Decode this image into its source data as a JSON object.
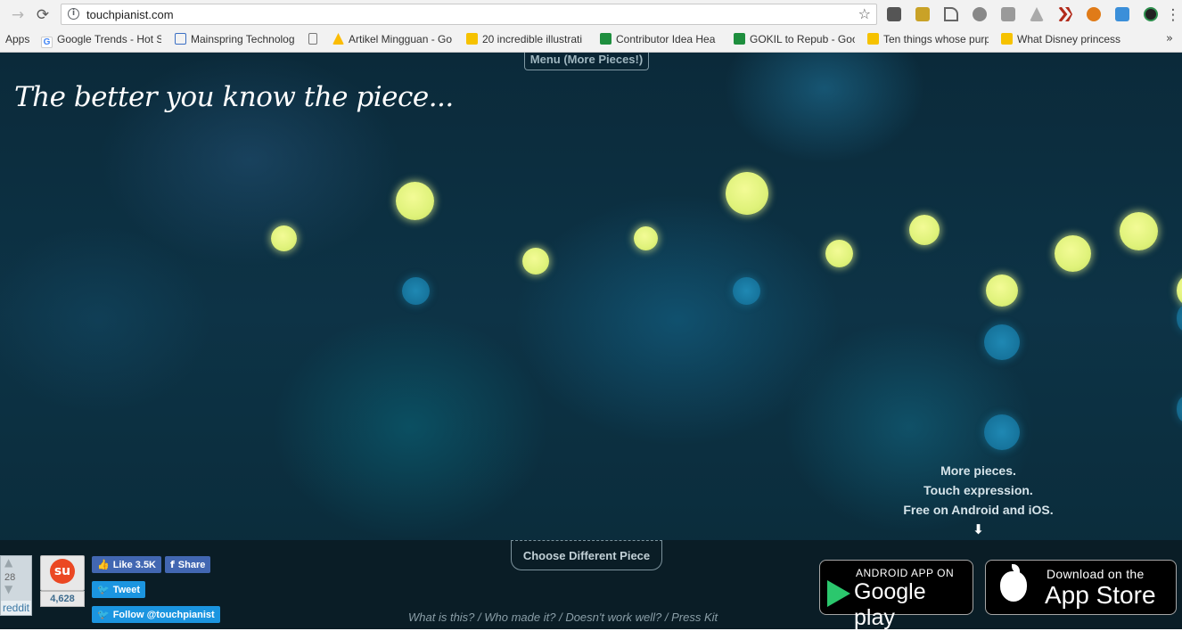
{
  "browser": {
    "url": "touchpianist.com",
    "nav": {
      "back": "→",
      "reload": "⟳"
    },
    "bookmark_star": "☆",
    "bookmarks": [
      {
        "label": "Apps",
        "icon": "apps-icon"
      },
      {
        "label": "Google Trends - Hot S",
        "icon": "google-icon"
      },
      {
        "label": "Mainspring Technolog",
        "icon": "link-icon"
      },
      {
        "label": "Artikel Mingguan - Go",
        "icon": "drive-icon"
      },
      {
        "label": "20 incredible illustrati",
        "icon": "bulb-icon"
      },
      {
        "label": "Contributor Idea Hea",
        "icon": "sheets-icon"
      },
      {
        "label": "GOKIL to Repub - Goo",
        "icon": "sheets-icon"
      },
      {
        "label": "Ten things whose purp",
        "icon": "bulb-icon"
      },
      {
        "label": "What Disney princess",
        "icon": "bulb-icon"
      }
    ],
    "bookmarks_overflow": "»",
    "extensions": [
      "youtube-icon",
      "blocker-icon",
      "arrow-ext-icon",
      "ext-circle-icon",
      "ext-box-icon",
      "ext-drive-icon",
      "ext-chevrons-icon",
      "ext-fox-icon",
      "ext-chat-icon",
      "ext-camera-icon"
    ],
    "menu": "⋮"
  },
  "page": {
    "menu_button": "Menu (More Pieces!)",
    "tagline": "The better you know the piece...",
    "promo": {
      "line1": "More pieces.",
      "line2": "Touch expression.",
      "line3": "Free on Android and iOS.",
      "arrow": "⬇"
    },
    "choose_button": "Choose Different Piece",
    "footer_links": [
      "What is this?",
      "Who made it?",
      "Doesn't work well?",
      "Press Kit"
    ],
    "footer_sep": " / ",
    "social": {
      "reddit_count": "28",
      "reddit_label": "reddit",
      "stumble_count": "4,628",
      "fb_like": "Like 3.5K",
      "fb_share": "Share",
      "tweet": "Tweet",
      "follow": "Follow @touchpianist"
    },
    "stores": {
      "android_top": "ANDROID APP ON",
      "android_main": "Google play",
      "ios_top": "Download on the",
      "ios_main": "App Store"
    }
  },
  "colors": {
    "note_yellow": "#dff27a",
    "note_blue": "#16739b",
    "background": "#0d3346"
  }
}
